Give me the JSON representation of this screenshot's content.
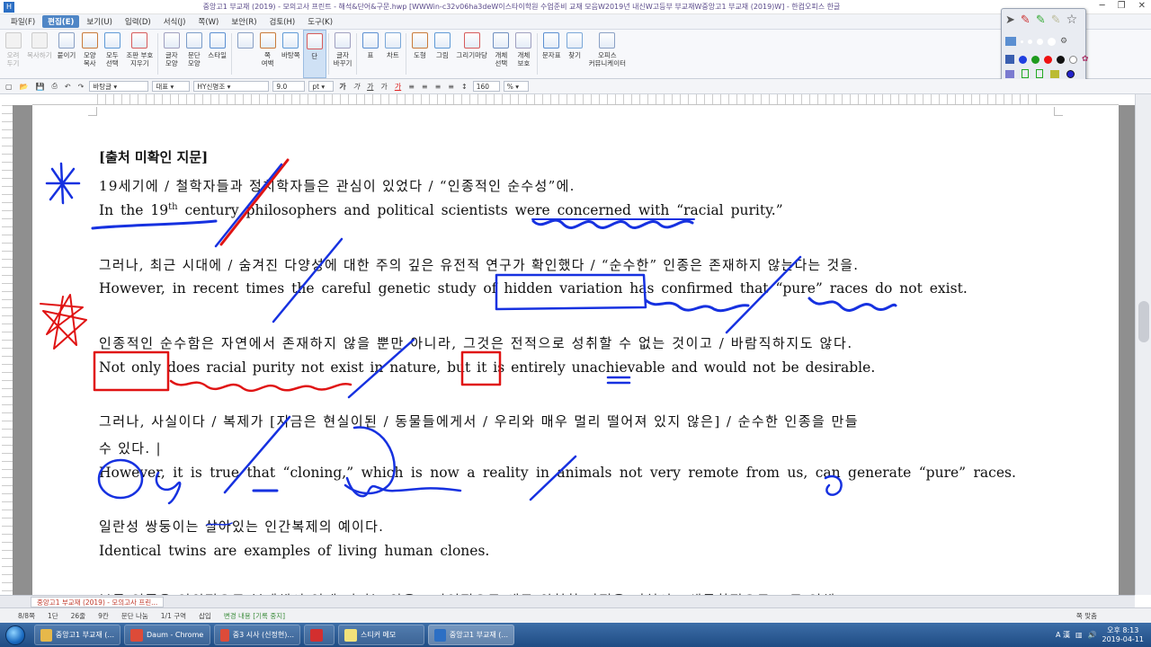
{
  "window": {
    "title": "중앙고1 부교재 (2019) - 모의고사 프린트 - 해석&단어&구문.hwp [WWWin-c32v06ha3deW이스타이학원 수업준비 교재 모음W2019년 내신W고등부 부교재W중앙고1 부교재 (2019)W] - 한컴오피스 한글",
    "app_icon": "H"
  },
  "menu": [
    {
      "label": "파일(F)"
    },
    {
      "label": "편집(E)",
      "active": true
    },
    {
      "label": "보기(U)"
    },
    {
      "label": "입력(D)"
    },
    {
      "label": "서식(J)"
    },
    {
      "label": "쪽(W)"
    },
    {
      "label": "보안(R)"
    },
    {
      "label": "검토(H)"
    },
    {
      "label": "도구(K)"
    }
  ],
  "ribbon": [
    {
      "label": "오려\n두기",
      "dis": true,
      "icon": "scissors-icon"
    },
    {
      "label": "복사하기",
      "dis": true,
      "icon": "copy-icon"
    },
    {
      "label": "붙이기",
      "icon": "paste-icon"
    },
    {
      "label": "모양\n복사",
      "icon": "format-painter-icon"
    },
    {
      "label": "모두\n선택",
      "icon": "select-all-icon"
    },
    {
      "label": "조판 부호\n지우기",
      "icon": "clear-codes-icon"
    },
    {
      "sep": true
    },
    {
      "label": "글자\n모양",
      "icon": "char-shape-icon"
    },
    {
      "label": "문단\n모양",
      "icon": "para-shape-icon"
    },
    {
      "label": "스타일",
      "icon": "style-icon"
    },
    {
      "sep": true
    },
    {
      "label": "",
      "icon": "page-icon"
    },
    {
      "label": "쪽\n여백",
      "icon": "page-margin-icon"
    },
    {
      "label": "바탕쪽",
      "icon": "master-page-icon"
    },
    {
      "label": "단",
      "sel": true,
      "icon": "column-icon"
    },
    {
      "sep": true
    },
    {
      "label": "글자\n바꾸기",
      "icon": "replace-char-icon"
    },
    {
      "sep": true
    },
    {
      "label": "표",
      "icon": "table-icon"
    },
    {
      "label": "차트",
      "icon": "chart-icon"
    },
    {
      "sep": true
    },
    {
      "label": "도형",
      "icon": "shape-icon"
    },
    {
      "label": "그림",
      "icon": "picture-icon"
    },
    {
      "label": "그리기마당",
      "icon": "clipart-icon"
    },
    {
      "label": "개체\n선택",
      "icon": "object-select-icon"
    },
    {
      "label": "개체\n보호",
      "icon": "object-protect-icon"
    },
    {
      "sep": true
    },
    {
      "label": "문자표",
      "icon": "symbol-icon"
    },
    {
      "label": "찾기",
      "icon": "find-icon"
    },
    {
      "label": "오피스\n커뮤니케이터",
      "icon": "communicator-icon"
    }
  ],
  "format": {
    "style": "바탕글",
    "font_lang": "대표",
    "font": "HY신명조",
    "size": "9.0",
    "unit": "pt",
    "zoom": "160",
    "zoom_unit": "%"
  },
  "document": {
    "heading": "[출처 미확인 지문]",
    "p1_ko": "19세기에 / 철학자들과 정치학자들은 관심이 있었다 / “인종적인 순수성”에.",
    "p1_en_a": "In the 19",
    "p1_en_sup": "th",
    "p1_en_b": " century philosophers and political scientists were concerned with “racial purity.”",
    "p2_ko": "그러나, 최근 시대에 / 숨겨진 다양성에 대한 주의 깊은 유전적 연구가 확인했다 / “순수한” 인종은 존재하지 않는다는 것을.",
    "p2_en": "However, in recent times the careful genetic study of hidden variation has confirmed that “pure” races do not exist.",
    "p3_ko": "인종적인 순수함은 자연에서 존재하지 않을 뿐만 아니라, 그것은 전적으로 성취할 수 없는 것이고 / 바람직하지도 않다.",
    "p3_en": "Not only does racial purity not exist in nature, but it is entirely unachievable and would not be desirable.",
    "p4_ko_a": "그러나, 사실이다 / 복제가 [지금은 현실이된 / 동물들에게서 / 우리와 매우 멀리 떨어져 있지 않은] / 순수한 인종을 만들",
    "p4_ko_b": "수 있다. |",
    "p4_en": "However, it is true that “cloning,” which is now a reality in animals not very remote from us, can generate “pure” races.",
    "p5_ko": "일란성 쌍둥이는 살아있는 인간복제의 예이다.",
    "p5_en": "Identical twins are examples of living human clones.",
    "p6_ko_partial": "부른 인종은 인위적으로 복제해서 얻게 되지는 않을 / 자연적으로 새로 위험한 과정을 거쳐서 / 생물학적으로 그로 인해"
  },
  "doctab": {
    "label": "중앙고1 부교재 (2019) - 모의고사 프린..."
  },
  "status": {
    "page": "8/8쪽",
    "section": "1단",
    "line": "26줄",
    "col": "9칸",
    "para": "문단 나눔",
    "area": "1/1 구역",
    "mode": "삽입",
    "track": "변경 내용 [기록 중지]",
    "zoom_fit": "쪽 맞춤"
  },
  "taskbar": {
    "items": [
      {
        "label": "중앙고1 부교재 (...",
        "color": "#e6b84a"
      },
      {
        "label": "Daum - Chrome",
        "color": "#dd4b39"
      },
      {
        "label": "중3 시사 (신정현)...",
        "color": "#dd4b39"
      },
      {
        "label": "",
        "color": "#d32f2f"
      },
      {
        "label": "스티커 메모",
        "color": "#f2e27a"
      },
      {
        "label": "중앙고1 부교재 (...",
        "color": "#2c6fc4",
        "active": true
      }
    ],
    "lang": "A 漢",
    "time": "오후 8:13",
    "date": "2019-04-11"
  }
}
